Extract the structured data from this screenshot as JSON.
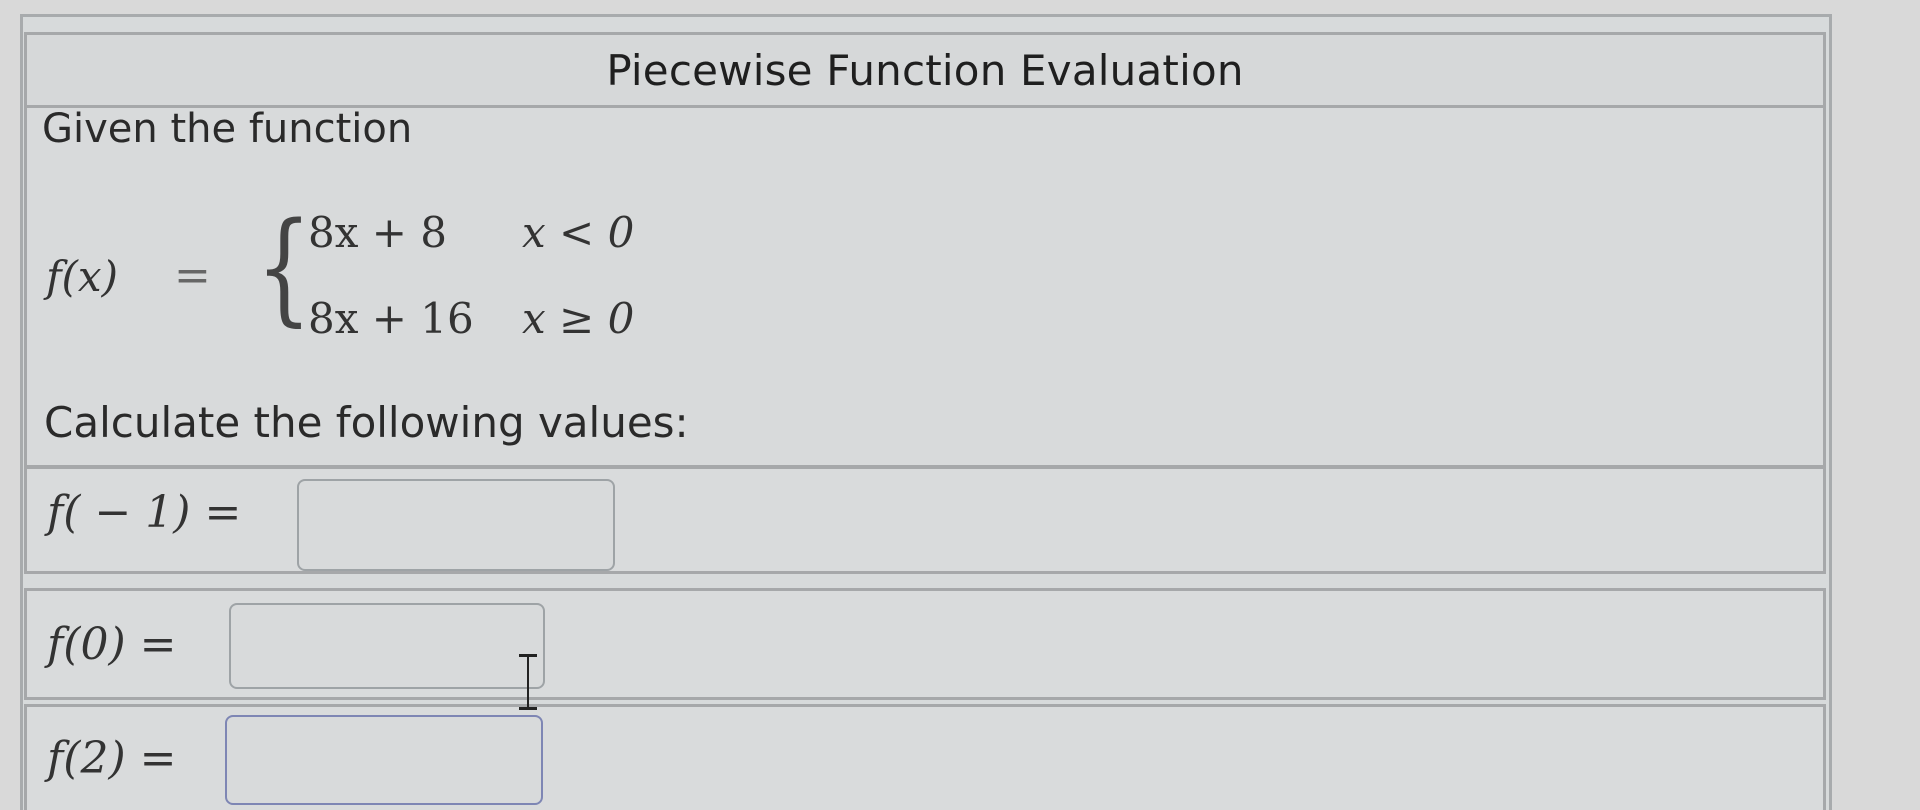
{
  "header": {
    "title": "Piecewise Function Evaluation"
  },
  "problem": {
    "intro": "Given the function",
    "function_name": "f(x)",
    "equals": "=",
    "cases": [
      {
        "expression": "8x + 8",
        "condition": "x < 0"
      },
      {
        "expression": "8x + 16",
        "condition": "x ≥ 0"
      }
    ],
    "prompt": "Calculate the following values:"
  },
  "answers": [
    {
      "label": "f( − 1) =",
      "value": ""
    },
    {
      "label": "f(0) =",
      "value": ""
    },
    {
      "label": "f(2) =",
      "value": ""
    }
  ],
  "icons": {
    "text_cursor": "text-cursor-icon"
  }
}
